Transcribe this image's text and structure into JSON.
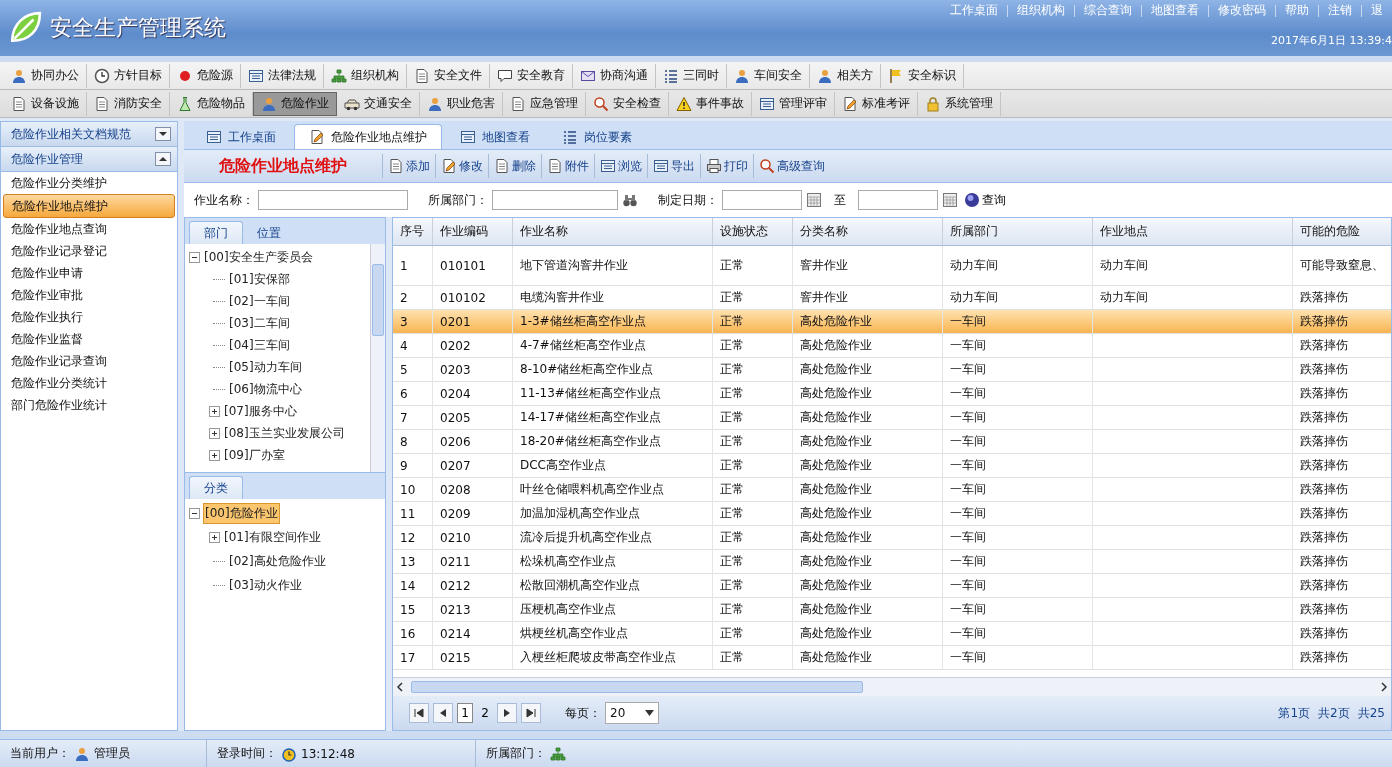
{
  "app": {
    "title": "安全生产管理系统",
    "top_links": [
      "工作桌面",
      "组织机构",
      "综合查询",
      "地图查看",
      "修改密码",
      "帮助",
      "注销",
      "退"
    ],
    "datetime": "2017年6月1日  13:39:4"
  },
  "modules_row_1": [
    {
      "label": "协同办公",
      "selected": false
    },
    {
      "label": "方针目标",
      "selected": false
    },
    {
      "label": "危险源",
      "selected": false
    },
    {
      "label": "法律法规",
      "selected": false
    },
    {
      "label": "组织机构",
      "selected": false
    },
    {
      "label": "安全文件",
      "selected": false
    },
    {
      "label": "安全教育",
      "selected": false
    },
    {
      "label": "协商沟通",
      "selected": false
    },
    {
      "label": "三同时",
      "selected": false
    },
    {
      "label": "车间安全",
      "selected": false
    },
    {
      "label": "相关方",
      "selected": false
    },
    {
      "label": "安全标识",
      "selected": false
    }
  ],
  "modules_row_2": [
    {
      "label": "设备设施",
      "selected": false
    },
    {
      "label": "消防安全",
      "selected": false
    },
    {
      "label": "危险物品",
      "selected": false
    },
    {
      "label": "危险作业",
      "selected": true
    },
    {
      "label": "交通安全",
      "selected": false
    },
    {
      "label": "职业危害",
      "selected": false
    },
    {
      "label": "应急管理",
      "selected": false
    },
    {
      "label": "安全检查",
      "selected": false
    },
    {
      "label": "事件事故",
      "selected": false
    },
    {
      "label": "管理评审",
      "selected": false
    },
    {
      "label": "标准考评",
      "selected": false
    },
    {
      "label": "系统管理",
      "selected": false
    }
  ],
  "sidebar": {
    "sections": [
      {
        "title": "危险作业相关文档规范",
        "expanded": false
      },
      {
        "title": "危险作业管理",
        "expanded": true,
        "items": [
          {
            "label": "危险作业分类维护",
            "selected": false
          },
          {
            "label": "危险作业地点维护",
            "selected": true
          },
          {
            "label": "危险作业地点查询",
            "selected": false
          },
          {
            "label": "危险作业记录登记",
            "selected": false
          },
          {
            "label": "危险作业申请",
            "selected": false
          },
          {
            "label": "危险作业审批",
            "selected": false
          },
          {
            "label": "危险作业执行",
            "selected": false
          },
          {
            "label": "危险作业监督",
            "selected": false
          },
          {
            "label": "危险作业记录查询",
            "selected": false
          },
          {
            "label": "危险作业分类统计",
            "selected": false
          },
          {
            "label": "部门危险作业统计",
            "selected": false
          }
        ]
      }
    ]
  },
  "tabs": [
    {
      "label": "工作桌面",
      "selected": false
    },
    {
      "label": "危险作业地点维护",
      "selected": true
    },
    {
      "label": "地图查看",
      "selected": false
    },
    {
      "label": "岗位要素",
      "selected": false
    }
  ],
  "page_title": "危险作业地点维护",
  "actions": [
    "添加",
    "修改",
    "删除",
    "附件",
    "浏览",
    "导出",
    "打印",
    "高级查询"
  ],
  "filters": {
    "name_label": "作业名称：",
    "dept_label": "所属部门：",
    "date_label": "制定日期：",
    "to_label": "至",
    "query_button": "查询"
  },
  "tree_tabs": [
    {
      "label": "部门",
      "selected": true
    },
    {
      "label": "位置",
      "selected": false
    }
  ],
  "dept_tree": [
    {
      "label": "[00]安全生产委员会",
      "kind": "folder",
      "expanded": true,
      "selected": false,
      "children": [
        {
          "label": "[01]安保部",
          "kind": "leaf",
          "selected": false
        },
        {
          "label": "[02]一车间",
          "kind": "leaf",
          "selected": false
        },
        {
          "label": "[03]二车间",
          "kind": "leaf",
          "selected": false
        },
        {
          "label": "[04]三车间",
          "kind": "leaf",
          "selected": false
        },
        {
          "label": "[05]动力车间",
          "kind": "leaf",
          "selected": false
        },
        {
          "label": "[06]物流中心",
          "kind": "leaf",
          "selected": false
        },
        {
          "label": "[07]服务中心",
          "kind": "folder",
          "expanded": false,
          "selected": false
        },
        {
          "label": "[08]玉兰实业发展公司",
          "kind": "folder",
          "expanded": false,
          "selected": false
        },
        {
          "label": "[09]厂办室",
          "kind": "folder",
          "expanded": false,
          "selected": false
        }
      ]
    }
  ],
  "category_header": "分类",
  "category_tree": [
    {
      "label": "[00]危险作业",
      "kind": "folder",
      "expanded": true,
      "selected": true,
      "children": [
        {
          "label": "[01]有限空间作业",
          "kind": "folder",
          "expanded": false,
          "selected": false
        },
        {
          "label": "[02]高处危险作业",
          "kind": "leaf",
          "selected": false
        },
        {
          "label": "[03]动火作业",
          "kind": "leaf",
          "selected": false
        }
      ]
    }
  ],
  "table": {
    "columns": [
      "序号",
      "作业编码",
      "作业名称",
      "设施状态",
      "分类名称",
      "所属部门",
      "作业地点",
      "可能的危险"
    ],
    "rows": [
      {
        "cells": [
          "1",
          "010101",
          "地下管道沟窨井作业",
          "正常",
          "窨井作业",
          "动力车间",
          "动力车间",
          "可能导致窒息、"
        ],
        "selected": false
      },
      {
        "cells": [
          "2",
          "010102",
          "电缆沟窨井作业",
          "正常",
          "窨井作业",
          "动力车间",
          "动力车间",
          "跌落摔伤"
        ],
        "selected": false
      },
      {
        "cells": [
          "3",
          "0201",
          "1-3#储丝柜高空作业点",
          "正常",
          "高处危险作业",
          "一车间",
          "",
          "跌落摔伤"
        ],
        "selected": true
      },
      {
        "cells": [
          "4",
          "0202",
          "4-7#储丝柜高空作业点",
          "正常",
          "高处危险作业",
          "一车间",
          "",
          "跌落摔伤"
        ],
        "selected": false
      },
      {
        "cells": [
          "5",
          "0203",
          "8-10#储丝柜高空作业点",
          "正常",
          "高处危险作业",
          "一车间",
          "",
          "跌落摔伤"
        ],
        "selected": false
      },
      {
        "cells": [
          "6",
          "0204",
          "11-13#储丝柜高空作业点",
          "正常",
          "高处危险作业",
          "一车间",
          "",
          "跌落摔伤"
        ],
        "selected": false
      },
      {
        "cells": [
          "7",
          "0205",
          "14-17#储丝柜高空作业点",
          "正常",
          "高处危险作业",
          "一车间",
          "",
          "跌落摔伤"
        ],
        "selected": false
      },
      {
        "cells": [
          "8",
          "0206",
          "18-20#储丝柜高空作业点",
          "正常",
          "高处危险作业",
          "一车间",
          "",
          "跌落摔伤"
        ],
        "selected": false
      },
      {
        "cells": [
          "9",
          "0207",
          "DCC高空作业点",
          "正常",
          "高处危险作业",
          "一车间",
          "",
          "跌落摔伤"
        ],
        "selected": false
      },
      {
        "cells": [
          "10",
          "0208",
          "叶丝仓储喂料机高空作业点",
          "正常",
          "高处危险作业",
          "一车间",
          "",
          "跌落摔伤"
        ],
        "selected": false
      },
      {
        "cells": [
          "11",
          "0209",
          "加温加湿机高空作业点",
          "正常",
          "高处危险作业",
          "一车间",
          "",
          "跌落摔伤"
        ],
        "selected": false
      },
      {
        "cells": [
          "12",
          "0210",
          "流冷后提升机高空作业点",
          "正常",
          "高处危险作业",
          "一车间",
          "",
          "跌落摔伤"
        ],
        "selected": false
      },
      {
        "cells": [
          "13",
          "0211",
          "松垛机高空作业点",
          "正常",
          "高处危险作业",
          "一车间",
          "",
          "跌落摔伤"
        ],
        "selected": false
      },
      {
        "cells": [
          "14",
          "0212",
          "松散回潮机高空作业点",
          "正常",
          "高处危险作业",
          "一车间",
          "",
          "跌落摔伤"
        ],
        "selected": false
      },
      {
        "cells": [
          "15",
          "0213",
          "压梗机高空作业点",
          "正常",
          "高处危险作业",
          "一车间",
          "",
          "跌落摔伤"
        ],
        "selected": false
      },
      {
        "cells": [
          "16",
          "0214",
          "烘梗丝机高空作业点",
          "正常",
          "高处危险作业",
          "一车间",
          "",
          "跌落摔伤"
        ],
        "selected": false
      },
      {
        "cells": [
          "17",
          "0215",
          "入梗丝柜爬坡皮带高空作业点",
          "正常",
          "高处危险作业",
          "一车间",
          "",
          "跌落摔伤"
        ],
        "selected": false
      }
    ]
  },
  "pager": {
    "pages": [
      {
        "label": "1",
        "selected": true
      },
      {
        "label": "2",
        "selected": false
      }
    ],
    "per_page_label": "每页：",
    "per_page": "20",
    "info": [
      "第1页",
      "共2页",
      "共25"
    ]
  },
  "status_bar": {
    "user_label": "当前用户：",
    "user": "管理员",
    "login_label": "登录时间：",
    "login_time": "13:12:48",
    "dept_label": "所属部门："
  }
}
